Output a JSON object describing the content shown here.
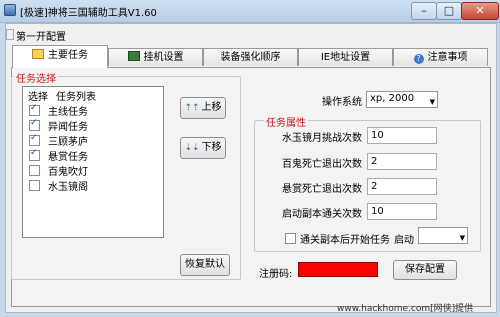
{
  "window": {
    "title": "[极速]神将三国辅助工具V1.60",
    "min_glyph": "–",
    "max_glyph": "□",
    "close_glyph": "✕"
  },
  "menu": {
    "label": "第一开配置"
  },
  "tabs": [
    {
      "label": "主要任务",
      "icon": "folder-icon"
    },
    {
      "label": "挂机设置",
      "icon": "book-icon"
    },
    {
      "label": "装备强化顺序",
      "icon": ""
    },
    {
      "label": "IE地址设置",
      "icon": ""
    },
    {
      "label": "注意事项",
      "icon": "help-icon"
    }
  ],
  "task_select": {
    "group_label": "任务选择",
    "header_select": "选择",
    "header_list": "任务列表",
    "tasks": [
      {
        "label": "主线任务",
        "checked": true
      },
      {
        "label": "异闻任务",
        "checked": true
      },
      {
        "label": "三顾茅庐",
        "checked": true
      },
      {
        "label": "悬赏任务",
        "checked": true
      },
      {
        "label": "百鬼吹灯",
        "checked": false
      },
      {
        "label": "水玉镜阁",
        "checked": false
      }
    ],
    "move_up": "上移",
    "move_down": "下移",
    "restore_default": "恢复默认"
  },
  "os": {
    "label": "操作系统",
    "value": "xp, 2000"
  },
  "task_attrs": {
    "group_label": "任务属性",
    "fields": [
      {
        "label": "水玉镜月挑战次数",
        "value": "10"
      },
      {
        "label": "百鬼死亡退出次数",
        "value": "2"
      },
      {
        "label": "悬赏死亡退出次数",
        "value": "2"
      },
      {
        "label": "启动副本通关次数",
        "value": "10"
      }
    ],
    "start_after_clear_label": "通关副本后开始任务",
    "start_after_clear_checked": false,
    "start_label": "启动",
    "start_value": ""
  },
  "register": {
    "label": "注册码:",
    "color": "#ff0000"
  },
  "save_button": "保存配置",
  "watermark": "www.hackhome.com[网侠]提供",
  "colors": {
    "accent_red": "#d1131a",
    "titlebar": "#b7cde6"
  }
}
